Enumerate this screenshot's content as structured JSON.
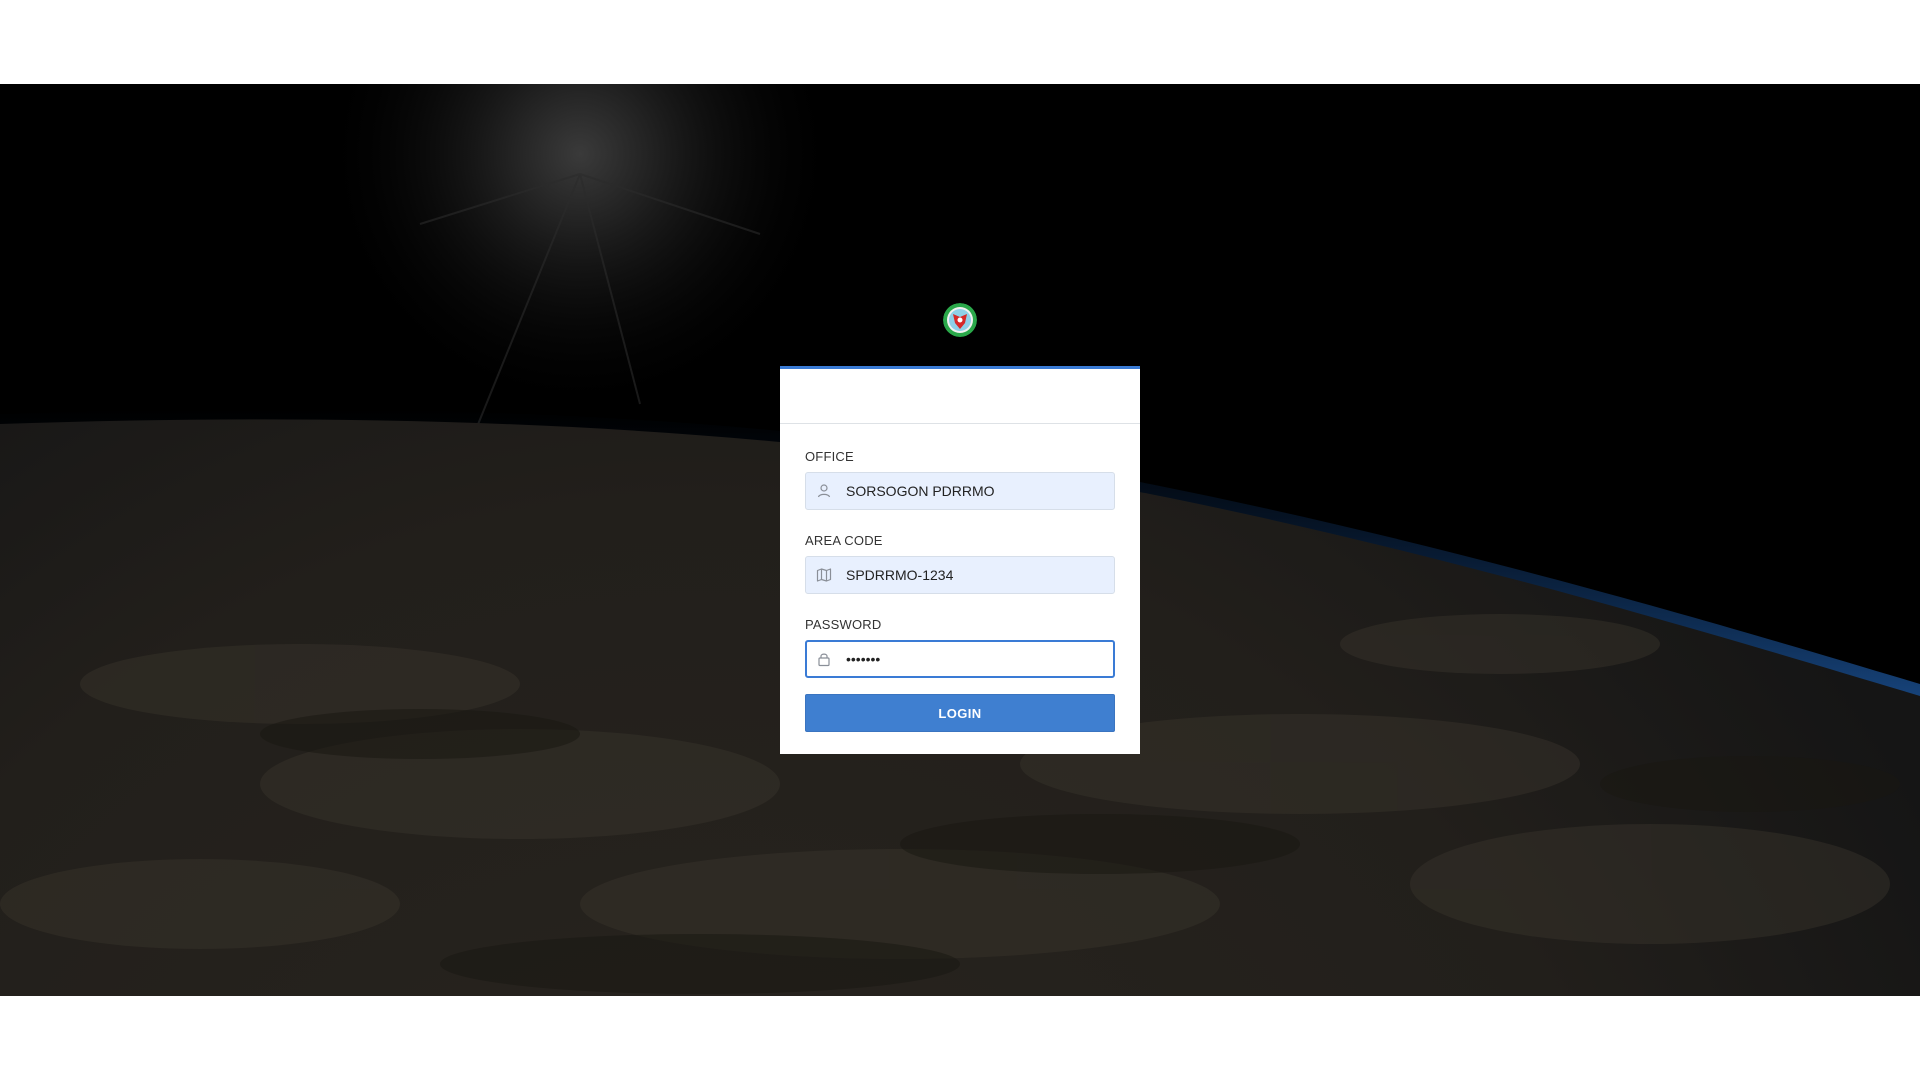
{
  "brand": {
    "logo_icon": "agency-seal-logo"
  },
  "form": {
    "office": {
      "label": "OFFICE",
      "value": "SORSOGON PDRRMO",
      "icon": "user-icon"
    },
    "area_code": {
      "label": "AREA CODE",
      "value": "SPDRRMO-1234",
      "icon": "map-icon"
    },
    "password": {
      "label": "PASSWORD",
      "value": "1234567",
      "icon": "lock-icon"
    },
    "login_label": "LOGIN"
  },
  "colors": {
    "accent": "#3f7fd0",
    "input_background": "#e8f0fe",
    "card_top_border": "#3a7bd5"
  }
}
